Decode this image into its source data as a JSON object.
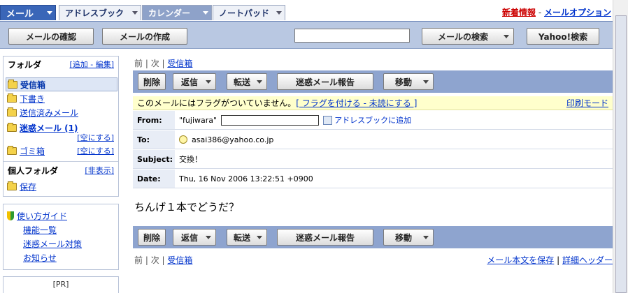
{
  "tabs": {
    "mail": "メール",
    "addressbook": "アドレスブック",
    "calendar": "カレンダー",
    "notepad": "ノートパッド"
  },
  "toplinks": {
    "new_info": "新着情報",
    "separator": " - ",
    "mail_options": "メールオプション"
  },
  "toolbar": {
    "check_mail": "メールの確認",
    "compose": "メールの作成",
    "search_placeholder": "",
    "search_mail": "メールの検索",
    "yahoo_search": "Yahoo!検索"
  },
  "sidebar": {
    "folders_title": "フォルダ",
    "folders_actions": "[追加 - 編集]",
    "folders": [
      {
        "label": "受信箱",
        "selected": true
      },
      {
        "label": "下書き"
      },
      {
        "label": "送信済みメール"
      },
      {
        "label": "迷惑メール (1)",
        "action": "[空にする]"
      },
      {
        "label": "ゴミ箱",
        "action": "[空にする]"
      }
    ],
    "personal_title": "個人フォルダ",
    "personal_action": "[非表示]",
    "personal_folders": [
      {
        "label": "保存"
      }
    ],
    "guide": [
      "使い方ガイド",
      "機能一覧",
      "迷惑メール対策",
      "お知らせ"
    ],
    "pr": "[PR]"
  },
  "nav": {
    "prev": "前",
    "sep": " | ",
    "next": "次",
    "inbox": "受信箱"
  },
  "actions": {
    "delete": "削除",
    "reply": "返信",
    "forward": "転送",
    "spam_report": "迷惑メール報告",
    "move": "移動"
  },
  "flag": {
    "text": "このメールにはフラグがついていません。",
    "links": "[ フラグを付ける - 未読にする ]",
    "print": "印刷モード"
  },
  "message": {
    "from_label": "From:",
    "from_name": "\"fujiwara\"",
    "add_to_addressbook": "アドレスブックに追加",
    "to_label": "To:",
    "to_value": "asai386@yahoo.co.jp",
    "subject_label": "Subject:",
    "subject_value": "交換！",
    "date_label": "Date:",
    "date_value": "Thu, 16 Nov 2006 13:22:51 +0900",
    "body": "ちんげ１本でどうだ？"
  },
  "footer": {
    "save_body": "メール本文を保存",
    "sep": " | ",
    "detail_header": "詳細ヘッダー"
  }
}
